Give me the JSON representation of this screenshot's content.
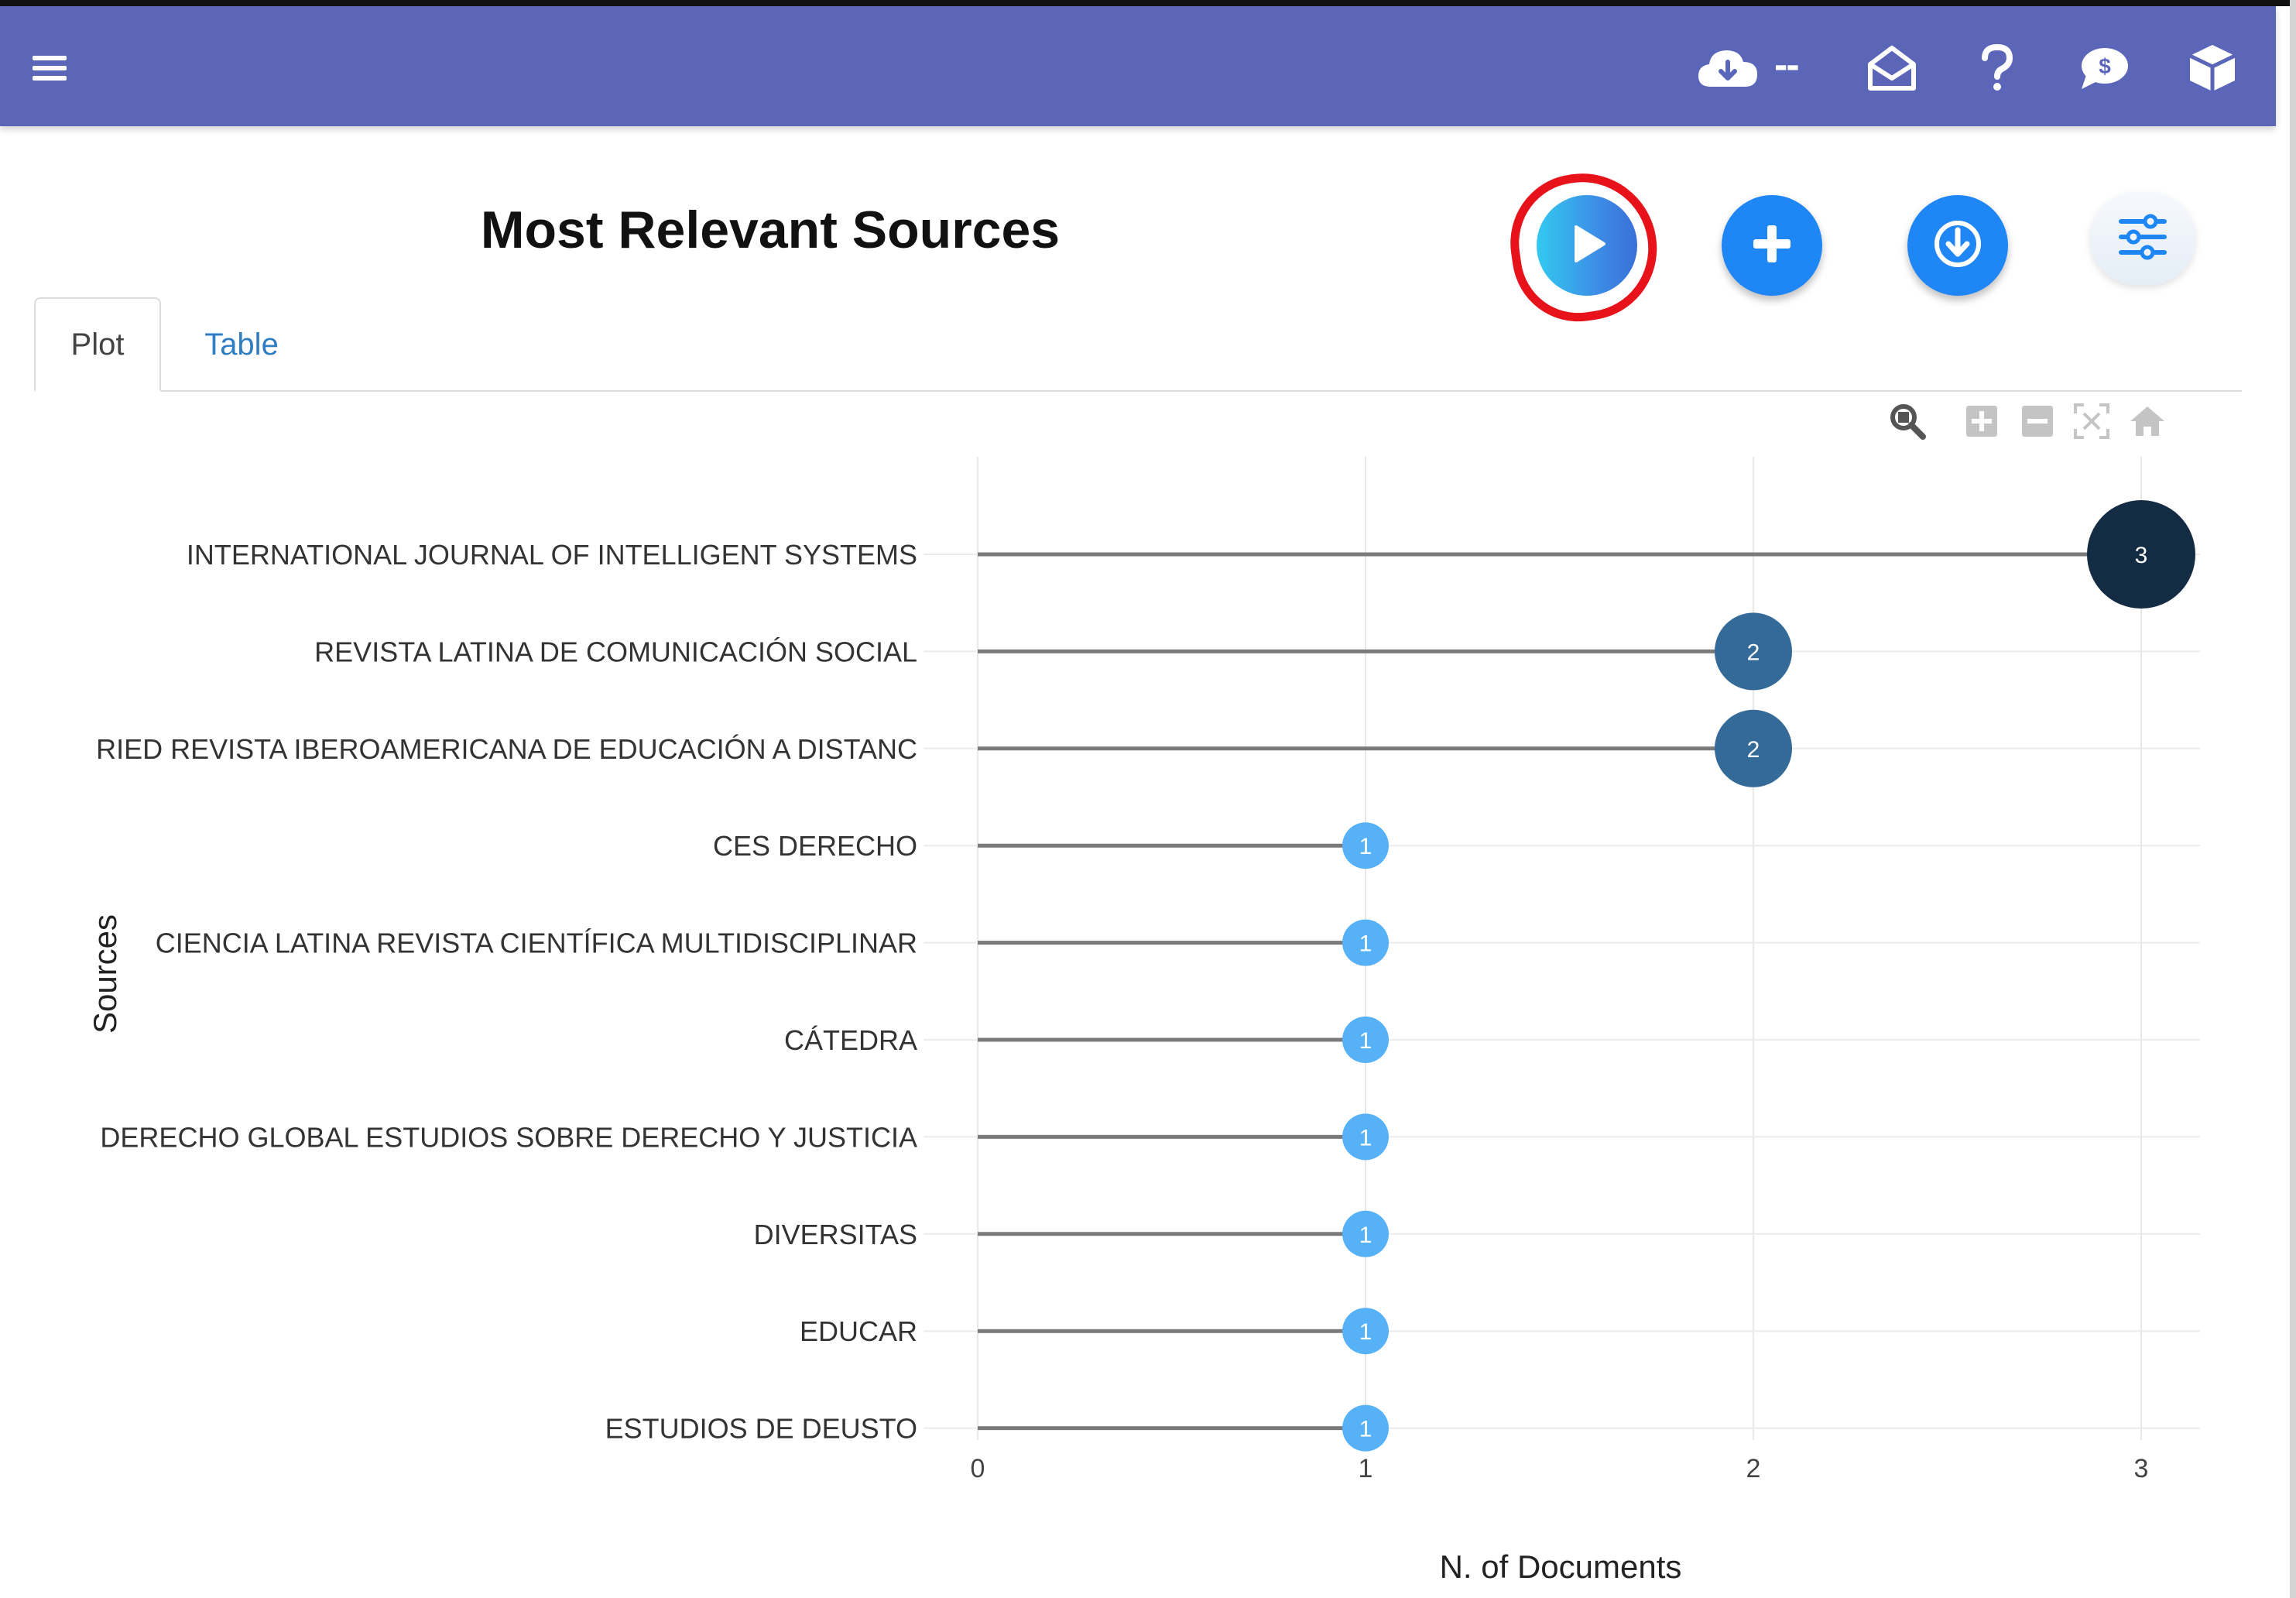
{
  "navbar": {
    "menu_icon": "hamburger-icon",
    "cloud_status": "--",
    "icons": [
      "cloud-download-icon",
      "envelope-open-icon",
      "help-icon",
      "donate-chat-icon",
      "package-icon"
    ]
  },
  "page": {
    "title": "Most Relevant Sources"
  },
  "actions": {
    "run": "play-icon",
    "add": "plus-icon",
    "download": "download-icon",
    "options": "sliders-icon"
  },
  "tabs": [
    {
      "label": "Plot",
      "active": true
    },
    {
      "label": "Table",
      "active": false
    }
  ],
  "modebar": [
    "zoom-icon",
    "zoom-in-icon",
    "zoom-out-icon",
    "autoscale-icon",
    "reset-axes-icon"
  ],
  "colors": {
    "navbar": "#5b66b9",
    "accent_blue": "#1f86f5",
    "annotation_red": "#e8121b",
    "dot_high": "#132b43",
    "dot_mid": "#336a98",
    "dot_low": "#56b1f7"
  },
  "chart_data": {
    "type": "scatter",
    "style": "lollipop",
    "xlabel": "N. of Documents",
    "ylabel": "Sources",
    "xlim": [
      0,
      3.15
    ],
    "xticks": [
      0,
      1,
      2,
      3
    ],
    "grid": true,
    "legend": "none",
    "categories": [
      "INTERNATIONAL JOURNAL OF INTELLIGENT SYSTEMS",
      "REVISTA LATINA DE COMUNICACIÓN SOCIAL",
      "RIED REVISTA IBEROAMERICANA DE EDUCACIÓN A DISTANC",
      "CES DERECHO",
      "CIENCIA LATINA REVISTA CIENTÍFICA MULTIDISCIPLINAR",
      "CÁTEDRA",
      "DERECHO GLOBAL ESTUDIOS SOBRE DERECHO Y JUSTICIA",
      "DIVERSITAS",
      "EDUCAR",
      "ESTUDIOS DE DEUSTO"
    ],
    "values": [
      3,
      2,
      2,
      1,
      1,
      1,
      1,
      1,
      1,
      1
    ]
  }
}
